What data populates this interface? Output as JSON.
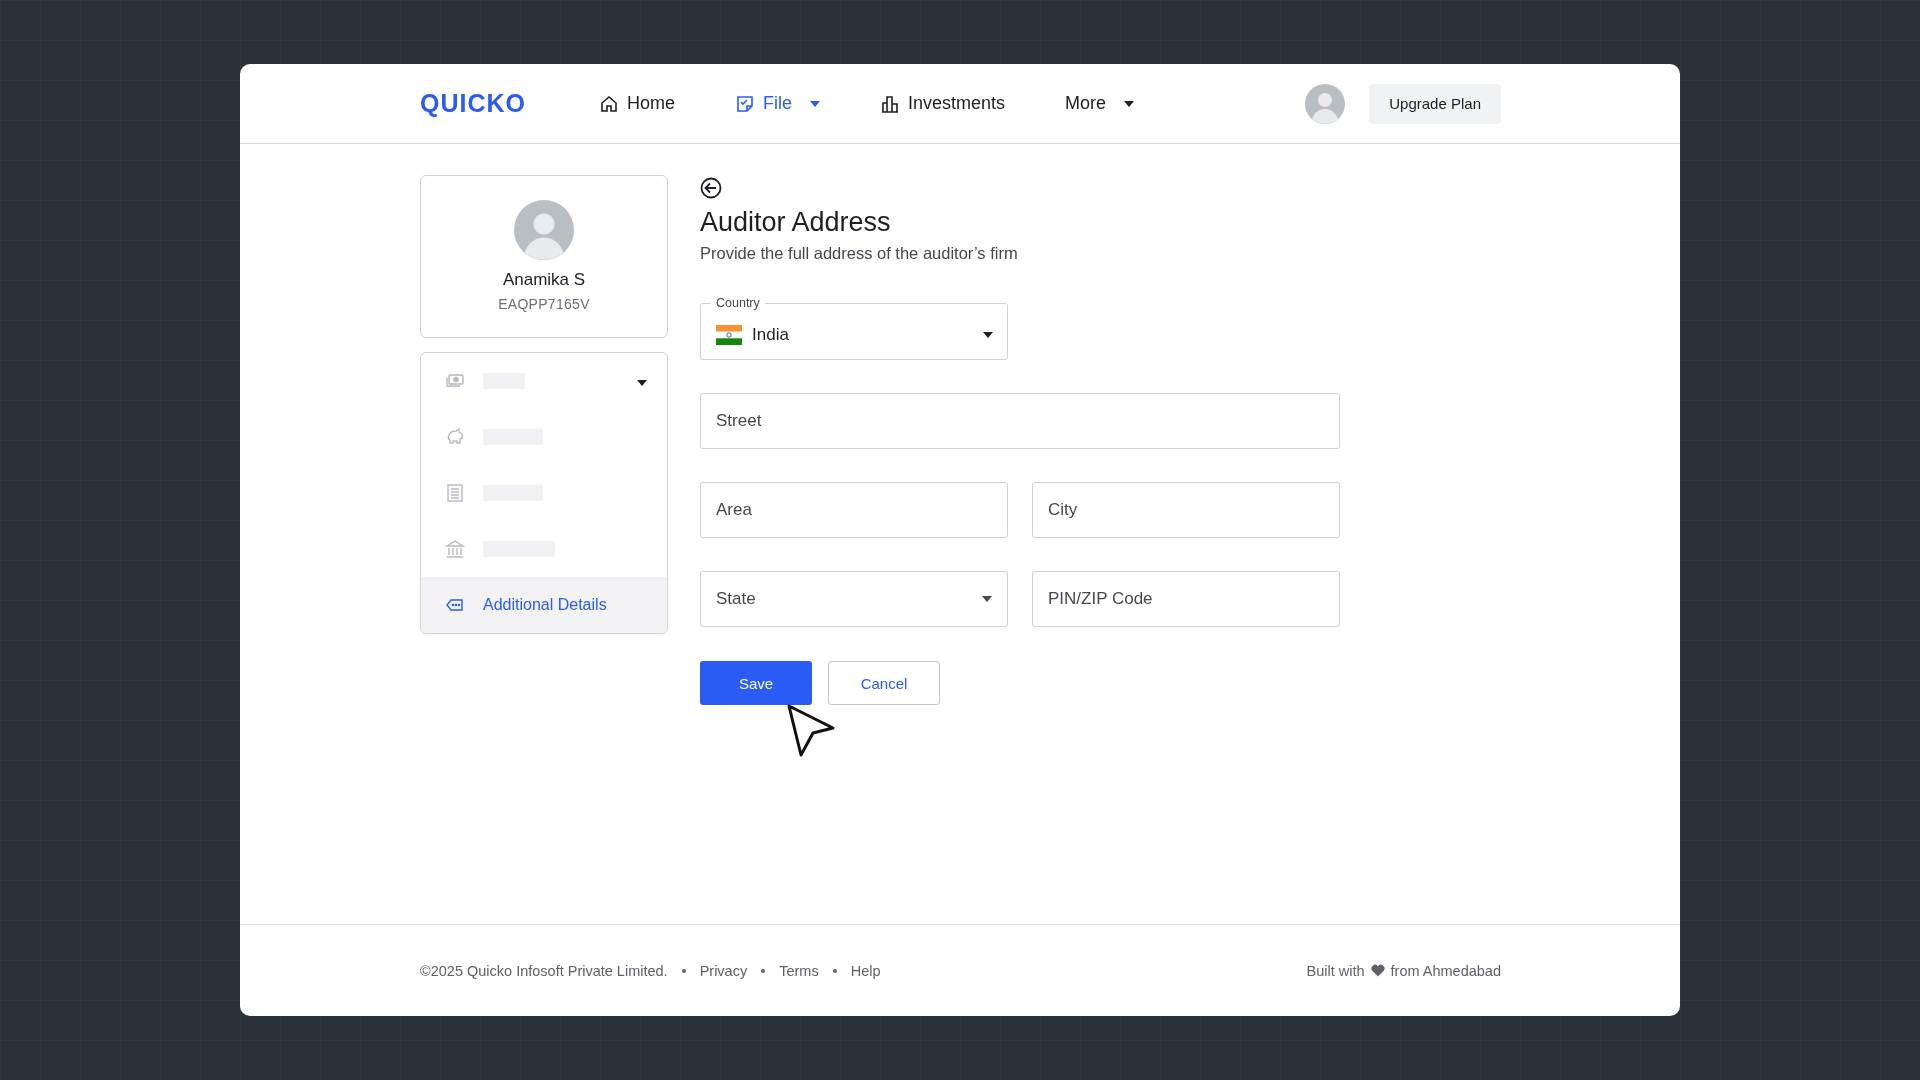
{
  "header": {
    "logo": "QUICKO",
    "nav": [
      {
        "label": "Home",
        "selected": false,
        "has_menu": false
      },
      {
        "label": "File",
        "selected": true,
        "has_menu": true
      },
      {
        "label": "Investments",
        "selected": false,
        "has_menu": false
      },
      {
        "label": "More",
        "selected": false,
        "has_menu": true
      }
    ],
    "upgrade_button": "Upgrade Plan"
  },
  "profile": {
    "name": "Anamika S",
    "pan": "EAQPP7165V"
  },
  "menu": [
    {
      "kind": "skeleton",
      "expandable": true,
      "selected": false
    },
    {
      "kind": "skeleton",
      "expandable": false,
      "selected": false
    },
    {
      "kind": "skeleton",
      "expandable": false,
      "selected": false
    },
    {
      "kind": "skeleton",
      "expandable": false,
      "selected": false
    },
    {
      "kind": "link",
      "label": "Additional Details",
      "expandable": false,
      "selected": true
    }
  ],
  "form": {
    "title": "Auditor Address",
    "subtitle": "Provide the full address of the auditor’s firm",
    "fields": [
      {
        "kind": "country",
        "label": "Country",
        "value": "India"
      },
      {
        "kind": "text",
        "placeholder": "Street",
        "wide": true
      },
      {
        "kind": "text",
        "placeholder": "Area",
        "wide": false
      },
      {
        "kind": "text",
        "placeholder": "City",
        "wide": false
      },
      {
        "kind": "select",
        "placeholder": "State",
        "wide": false
      },
      {
        "kind": "text",
        "placeholder": "PIN/ZIP Code",
        "wide": false
      }
    ],
    "buttons": [
      {
        "label": "Save",
        "kind": "primary"
      },
      {
        "label": "Cancel",
        "kind": "secondary"
      }
    ]
  },
  "footer": {
    "copyright": "©2025 Quicko Infosoft Private Limited.",
    "links": [
      "Privacy",
      "Terms",
      "Help"
    ],
    "credit_before": "Built with",
    "credit_after": "from Ahmedabad"
  }
}
